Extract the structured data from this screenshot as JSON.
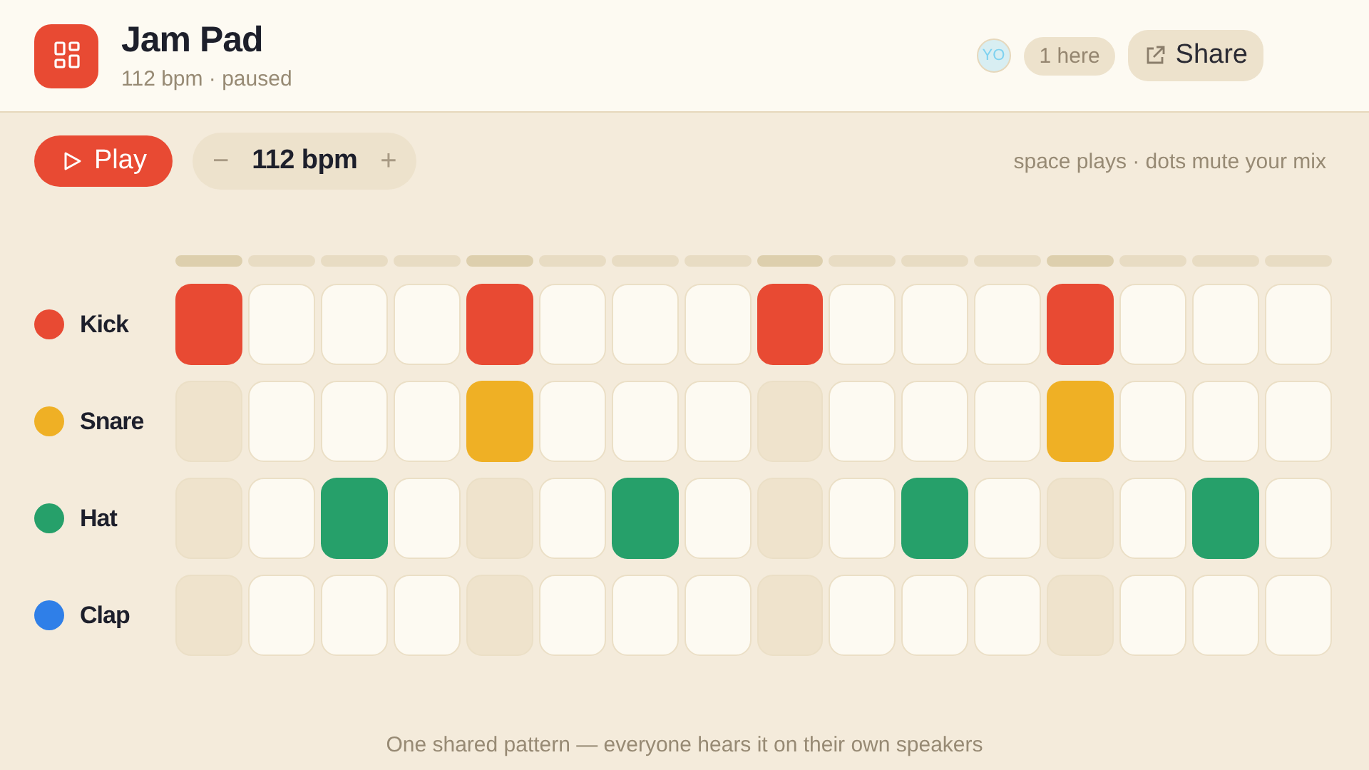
{
  "app": {
    "title": "Jam Pad",
    "subtitle": "112 bpm · paused"
  },
  "presence": {
    "avatar": "YO",
    "count": "1 here"
  },
  "share_button": {
    "label": "Share"
  },
  "play_button": {
    "label": "Play"
  },
  "tempo": {
    "decrease": "−",
    "value": "112 bpm",
    "increase": "+"
  },
  "hint": "space plays · dots mute your mix",
  "tracks": [
    {
      "name": "Kick",
      "color": "#e84a33",
      "steps": [
        true,
        false,
        false,
        false,
        true,
        false,
        false,
        false,
        true,
        false,
        false,
        false,
        true,
        false,
        false,
        false
      ]
    },
    {
      "name": "Snare",
      "color": "#efb025",
      "steps": [
        false,
        false,
        false,
        false,
        true,
        false,
        false,
        false,
        false,
        false,
        false,
        false,
        true,
        false,
        false,
        false
      ]
    },
    {
      "name": "Hat",
      "color": "#26a06a",
      "steps": [
        false,
        false,
        true,
        false,
        false,
        false,
        true,
        false,
        false,
        false,
        true,
        false,
        false,
        false,
        true,
        false
      ]
    },
    {
      "name": "Clap",
      "color": "#2f7fe8",
      "steps": [
        false,
        false,
        false,
        false,
        false,
        false,
        false,
        false,
        false,
        false,
        false,
        false,
        false,
        false,
        false,
        false
      ]
    }
  ],
  "footer": "One shared pattern — everyone hears it on their own speakers"
}
